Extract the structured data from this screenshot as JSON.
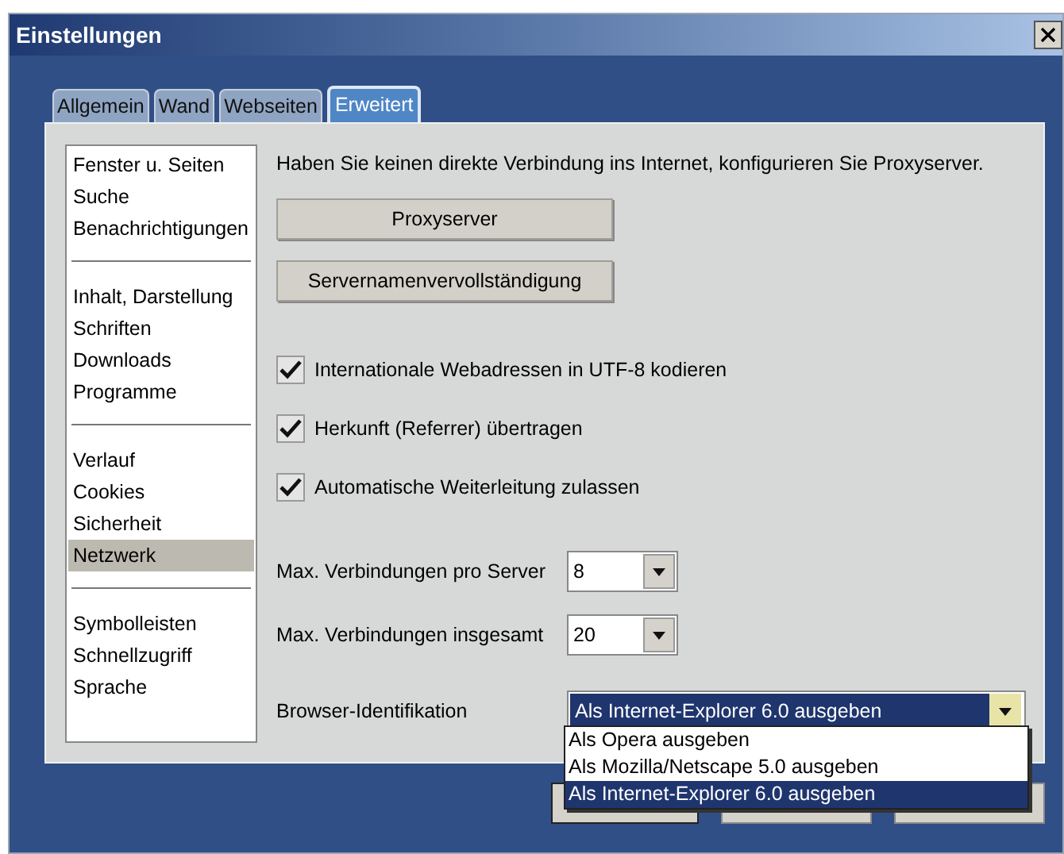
{
  "window": {
    "title": "Einstellungen"
  },
  "tabs": [
    {
      "label": "Allgemein",
      "selected": false
    },
    {
      "label": "Wand",
      "selected": false
    },
    {
      "label": "Webseiten",
      "selected": false
    },
    {
      "label": "Erweitert",
      "selected": true
    }
  ],
  "sidebar": {
    "groups": [
      {
        "items": [
          {
            "label": "Fenster u. Seiten",
            "selected": false
          },
          {
            "label": "Suche",
            "selected": false
          },
          {
            "label": "Benachrichtigungen",
            "selected": false
          }
        ]
      },
      {
        "items": [
          {
            "label": "Inhalt, Darstellung",
            "selected": false
          },
          {
            "label": "Schriften",
            "selected": false
          },
          {
            "label": "Downloads",
            "selected": false
          },
          {
            "label": "Programme",
            "selected": false
          }
        ]
      },
      {
        "items": [
          {
            "label": "Verlauf",
            "selected": false
          },
          {
            "label": "Cookies",
            "selected": false
          },
          {
            "label": "Sicherheit",
            "selected": false
          },
          {
            "label": "Netzwerk",
            "selected": true
          }
        ]
      },
      {
        "items": [
          {
            "label": "Symbolleisten",
            "selected": false
          },
          {
            "label": "Schnellzugriff",
            "selected": false
          },
          {
            "label": "Sprache",
            "selected": false
          }
        ]
      }
    ]
  },
  "content": {
    "intro": "Haben Sie keinen direkte Verbindung ins Internet, konfigurieren Sie Proxyserver.",
    "buttons": [
      "Proxyserver",
      "Servernamenvervollständigung"
    ],
    "checkboxes": [
      {
        "label": "Internationale Webadressen in UTF-8 kodieren",
        "checked": true
      },
      {
        "label": "Herkunft (Referrer) übertragen",
        "checked": true
      },
      {
        "label": "Automatische Weiterleitung zulassen",
        "checked": true
      }
    ],
    "fields": [
      {
        "label": "Max. Verbindungen pro Server",
        "value": "8"
      },
      {
        "label": "Max. Verbindungen insgesamt",
        "value": "20"
      }
    ],
    "browser_id": {
      "label": "Browser-Identifikation",
      "value": "Als Internet-Explorer 6.0 ausgeben",
      "expanded": true,
      "options": [
        {
          "label": "Als Opera ausgeben",
          "selected": false
        },
        {
          "label": "Als Mozilla/Netscape 5.0 ausgeben",
          "selected": false
        },
        {
          "label": "Als Internet-Explorer 6.0 ausgeben",
          "selected": true
        }
      ]
    }
  }
}
